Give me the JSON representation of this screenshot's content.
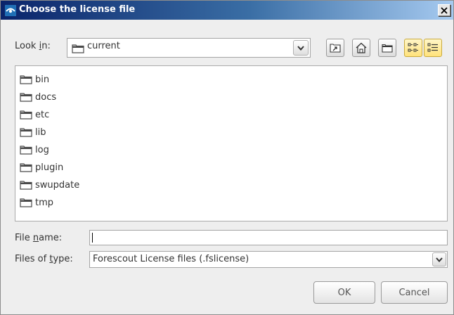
{
  "window": {
    "title": "Choose the license file",
    "close_label": "Close"
  },
  "look_in": {
    "label_pre": "Look ",
    "label_mnemonic": "i",
    "label_post": "n:",
    "value": "current"
  },
  "toolbar": {
    "buttons": [
      {
        "name": "up-one-level",
        "icon": "up-folder-icon"
      },
      {
        "name": "home",
        "icon": "home-icon"
      },
      {
        "name": "create-new-folder",
        "icon": "new-folder-icon"
      },
      {
        "name": "list-view",
        "icon": "list-view-icon",
        "active": true
      },
      {
        "name": "details-view",
        "icon": "details-view-icon",
        "active": true
      }
    ]
  },
  "files": [
    {
      "name": "bin",
      "icon": "folder-icon"
    },
    {
      "name": "docs",
      "icon": "folder-icon"
    },
    {
      "name": "etc",
      "icon": "folder-icon"
    },
    {
      "name": "lib",
      "icon": "folder-icon"
    },
    {
      "name": "log",
      "icon": "folder-icon"
    },
    {
      "name": "plugin",
      "icon": "folder-icon"
    },
    {
      "name": "swupdate",
      "icon": "folder-icon"
    },
    {
      "name": "tmp",
      "icon": "folder-icon"
    }
  ],
  "file_name": {
    "label_pre": "File ",
    "label_mnemonic": "n",
    "label_post": "ame:",
    "value": "",
    "placeholder": ""
  },
  "file_type": {
    "label_pre": "Files of ",
    "label_mnemonic": "t",
    "label_post": "ype:",
    "value": "Forescout License files (.fslicense)"
  },
  "buttons": {
    "ok": "OK",
    "cancel": "Cancel"
  },
  "colors": {
    "title_bar_start": "#0a246a",
    "title_bar_end": "#a6caf0",
    "dialog_bg": "#eeeeee",
    "active_toggle": "#ffe27a"
  }
}
